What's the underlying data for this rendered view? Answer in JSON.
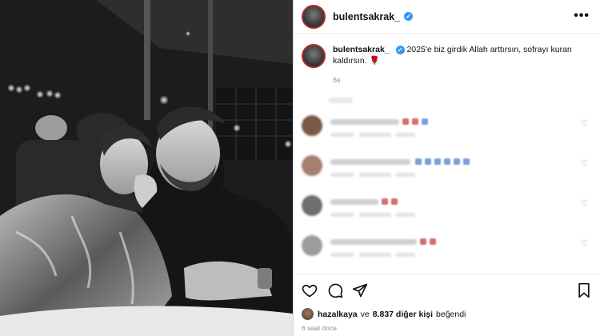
{
  "post": {
    "username": "bulentsakrak_",
    "verified_mark": "✓",
    "more_label": "•••",
    "caption_username": "bulentsakrak_",
    "caption_text": "2025'e biz girdik Allah arttırsın, sofrayı kuran kaldırsın. 🌹",
    "caption_time": "6s",
    "likes_user": "hazalkaya",
    "likes_connector": "ve",
    "likes_count": "8.837 diğer kişi",
    "likes_verb": "beğendi",
    "posted_ago": "6 saat önce"
  },
  "comments": [
    {
      "avatar_color": "#7a5a45"
    },
    {
      "avatar_color": "#a57f6f"
    },
    {
      "avatar_color": "#6f6f6f"
    },
    {
      "avatar_color": "#9c9c9c"
    }
  ],
  "icons": {
    "like": "heart-icon",
    "comment": "comment-icon",
    "share": "share-icon",
    "save": "bookmark-icon",
    "more": "more-options-icon"
  },
  "colors": {
    "verified": "#3897f0",
    "story_ring": "#b22a2a",
    "text_secondary": "#8e8e8e"
  }
}
